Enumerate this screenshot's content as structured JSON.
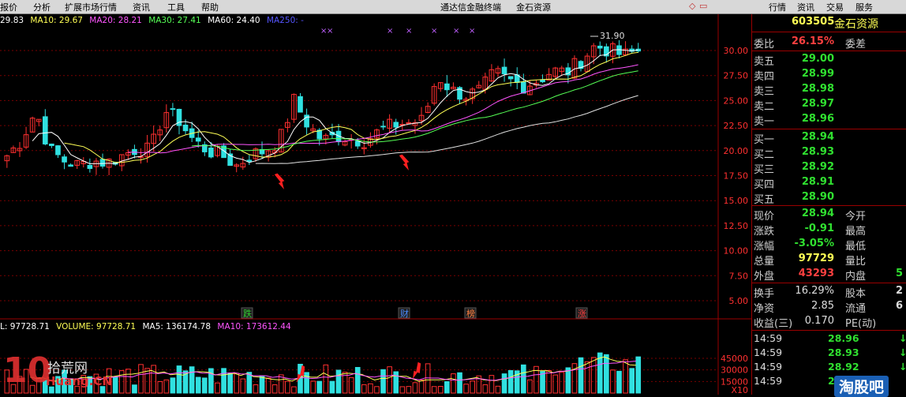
{
  "menu": {
    "items": [
      "报价",
      "分析",
      "扩展市场行情",
      "资讯",
      "工具",
      "帮助"
    ],
    "app_title": "通达信金融终端",
    "stock_title": "金石资源",
    "right_tabs": [
      "行情",
      "资讯",
      "交易",
      "服务"
    ]
  },
  "ma_bar": {
    "items": [
      {
        "text": "29.83",
        "color": "#ffffff"
      },
      {
        "text": "MA10: 29.67",
        "color": "#ffff55"
      },
      {
        "text": "MA20: 28.21",
        "color": "#ff55ff"
      },
      {
        "text": "MA30: 27.41",
        "color": "#55ff55"
      },
      {
        "text": "MA60: 24.40",
        "color": "#ffffff"
      },
      {
        "text": "MA250: -",
        "color": "#5555ff"
      }
    ]
  },
  "price_axis": [
    "30.00",
    "27.50",
    "25.00",
    "22.50",
    "20.00",
    "17.50",
    "15.00",
    "12.50",
    "10.00",
    "7.50",
    "5.00"
  ],
  "volume_axis": [
    "45000",
    "30000",
    "15000",
    "X10"
  ],
  "peak_label": "31.90",
  "event_markers": [
    {
      "label": "跌",
      "color": "#30d030"
    },
    {
      "label": "财",
      "color": "#4a8cff"
    },
    {
      "label": "榜",
      "color": "#ff8040"
    },
    {
      "label": "涨",
      "color": "#ff4040"
    }
  ],
  "volume_bar": {
    "items": [
      {
        "text": "L: 97728.71",
        "color": "#ffffff"
      },
      {
        "text": "VOLUME: 97728.71",
        "color": "#ffff55"
      },
      {
        "text": "MA5: 136174.78",
        "color": "#ffffff"
      },
      {
        "text": "MA10: 173612.44",
        "color": "#ff55ff"
      }
    ]
  },
  "watermark_left": {
    "big": "10",
    "line1": "拾荒网",
    "line2": "Huang.CN"
  },
  "watermark_right": "淘股吧",
  "quote": {
    "code": "603505",
    "name": "金石资源",
    "weibi_label": "委比",
    "weibi_value": "26.15%",
    "weicha_label": "委差",
    "asks": [
      {
        "label": "卖五",
        "price": "29.00"
      },
      {
        "label": "卖四",
        "price": "28.99"
      },
      {
        "label": "卖三",
        "price": "28.98"
      },
      {
        "label": "卖二",
        "price": "28.97"
      },
      {
        "label": "卖一",
        "price": "28.96"
      }
    ],
    "bids": [
      {
        "label": "买一",
        "price": "28.94"
      },
      {
        "label": "买二",
        "price": "28.93"
      },
      {
        "label": "买三",
        "price": "28.92"
      },
      {
        "label": "买四",
        "price": "28.91"
      },
      {
        "label": "买五",
        "price": "28.90"
      }
    ],
    "stats": [
      {
        "label": "现价",
        "value": "28.94",
        "color": "#30e030",
        "label2": "今开",
        "value2": ""
      },
      {
        "label": "涨跌",
        "value": "-0.91",
        "color": "#30e030",
        "label2": "最高",
        "value2": ""
      },
      {
        "label": "涨幅",
        "value": "-3.05%",
        "color": "#30e030",
        "label2": "最低",
        "value2": ""
      },
      {
        "label": "总量",
        "value": "97729",
        "color": "#ffff55",
        "label2": "量比",
        "value2": ""
      },
      {
        "label": "外盘",
        "value": "43293",
        "color": "#ff4040",
        "label2": "内盘",
        "value2": "5"
      }
    ],
    "stats2": [
      {
        "label": "换手",
        "value": "16.29%",
        "color": "#dddddd",
        "label2": "股本",
        "value2": "2"
      },
      {
        "label": "净资",
        "value": "2.85",
        "color": "#dddddd",
        "label2": "流通",
        "value2": "6"
      },
      {
        "label": "收益(三)",
        "value": "0.170",
        "color": "#dddddd",
        "label2": "PE(动)",
        "value2": ""
      }
    ],
    "trades": [
      {
        "time": "14:59",
        "price": "28.96",
        "arrow": "↓"
      },
      {
        "time": "14:59",
        "price": "28.93",
        "arrow": "↓"
      },
      {
        "time": "14:59",
        "price": "28.92",
        "arrow": "↓"
      },
      {
        "time": "14:59",
        "price": "28.93",
        "arrow": ""
      }
    ]
  },
  "colors": {
    "up": "#ff3030",
    "down": "#30e0e0",
    "ma5": "#ffffff",
    "ma10": "#ffff55",
    "ma20": "#ff55ff",
    "ma30": "#55ff55",
    "panel_border": "#9a0000"
  }
}
